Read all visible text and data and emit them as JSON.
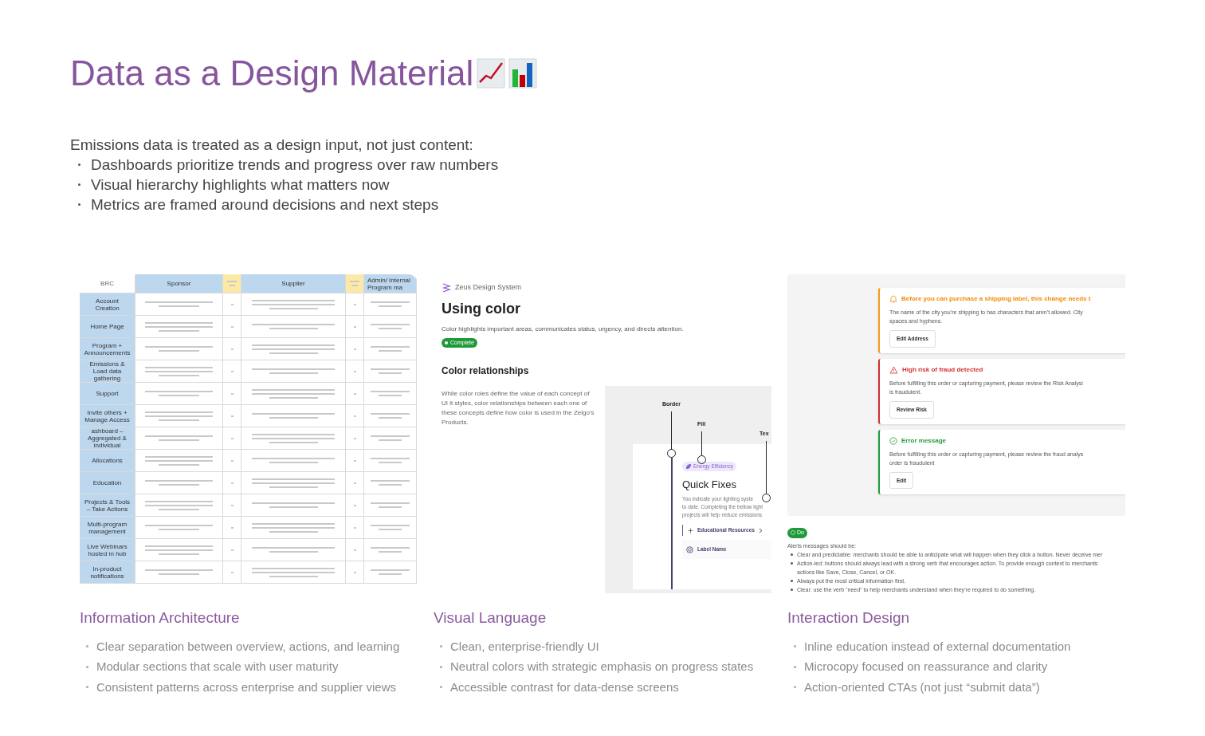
{
  "title": "Data as a Design Material",
  "intro": {
    "lead": "Emissions data is treated as a design input, not just content:",
    "bullets": [
      "Dashboards prioritize trends and progress over raw numbers",
      "Visual hierarchy highlights what matters now",
      "Metrics are framed around decisions and next steps"
    ]
  },
  "showcases": [
    {
      "kind": "spreadsheet",
      "caption": "Information Architecture",
      "bullets": [
        "Clear separation between overview, actions, and learning",
        "Modular sections that scale with user maturity",
        "Consistent patterns across enterprise and supplier views"
      ],
      "sheet": {
        "corner": "BRC",
        "columns": [
          "Sponsor",
          "Supplier",
          "Admin/ Internal Program ma"
        ],
        "rows": [
          {
            "label": "Account Creation"
          },
          {
            "label": "Home Page"
          },
          {
            "label": "Program + Announcements"
          },
          {
            "label": "Emissions & Load data gathering"
          },
          {
            "label": "Support"
          },
          {
            "label": "Invite others + Manage Access"
          },
          {
            "label": "ashboard – Aggregated & individual"
          },
          {
            "label": "Allocations"
          },
          {
            "label": "Education"
          },
          {
            "label": "Projects & Tools – Take Actions"
          },
          {
            "label": "Multi-program management"
          },
          {
            "label": "Live Webinars hosted in hub"
          },
          {
            "label": "In-product notifications"
          }
        ]
      }
    },
    {
      "kind": "design_system",
      "caption": "Visual Language",
      "bullets": [
        "Clean, enterprise-friendly UI",
        "Neutral colors with strategic emphasis on progress states",
        "Accessible contrast for data-dense screens"
      ],
      "brand": "Zeus Design System",
      "heading": "Using color",
      "description": "Color highlights important areas, communicates status, urgency, and directs attention.",
      "status": "Complete",
      "subheading": "Color relationships",
      "paragraph": "While color roles define the value of each concept of UI it styles, color relationships between each one of these concepts define how color is used in the Zeigo's Products.",
      "diagram": {
        "callouts": [
          "Border",
          "Fill",
          "Tex"
        ],
        "chip": "Energy Efficiency",
        "card_title": "Quick Fixes",
        "card_lines": [
          "You indicate your lighting syste",
          "to date. Completing the bellow light",
          "projects will help reduce emissions"
        ],
        "links": [
          {
            "kind": "expand",
            "label": "Educational Resources"
          },
          {
            "kind": "item",
            "label": "Label Name"
          }
        ]
      }
    },
    {
      "kind": "alerts",
      "caption": "Interaction Design",
      "bullets": [
        "Inline education instead of external documentation",
        "Microcopy focused on reassurance and clarity",
        "Action-oriented CTAs (not just “submit data”)"
      ],
      "alerts": [
        {
          "kind": "warning",
          "title": "Before you can purchase a shipping label, this change needs t",
          "lines": [
            "The name of the city you’re shipping to has characters that aren’t allowed. City",
            "spaces and hyphens."
          ],
          "action": "Edit Address"
        },
        {
          "kind": "critical",
          "title": "High risk of fraud detected",
          "lines": [
            "Before fulfilling this order or capturing payment, please review the Risk Analysi",
            "is fraudulent."
          ],
          "action": "Review Risk"
        },
        {
          "kind": "success",
          "title": "Error message",
          "lines": [
            "Before fulfilling this order or capturing payment, please review the fraud analys",
            "order is fraudulent"
          ],
          "action": "Edit"
        }
      ],
      "guidance": {
        "badge": "Do",
        "lead": "Alerts messages should be:",
        "bullets": [
          {
            "lines": [
              "Clear and predictable: merchants should be able to anticipate what will happen when they click a button. Never deceive mer"
            ]
          },
          {
            "lines": [
              "Action-led: buttons should always lead with a strong verb that encourages action. To provide enough context to merchants",
              "actions like Save, Close, Cancel, or OK."
            ]
          },
          {
            "lines": [
              "Always put the most critical information first."
            ]
          },
          {
            "lines": [
              "Clear: use the verb \"need\" to help merchants understand when they’re required to do something."
            ]
          }
        ]
      }
    }
  ]
}
